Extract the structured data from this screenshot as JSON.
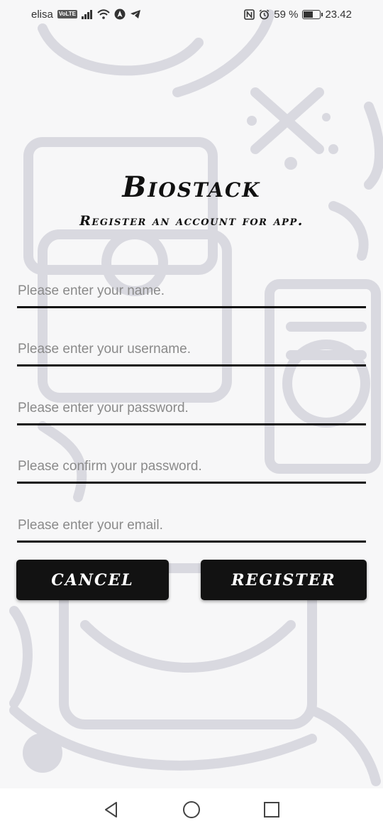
{
  "status_bar": {
    "carrier": "elisa",
    "volte_badge": "VoLTE",
    "battery_text": "59 %",
    "battery_level": 0.59,
    "time": "23.42",
    "icons": [
      "signal-icon",
      "wifi-icon",
      "navigation-icon",
      "telegram-icon",
      "nfc-icon",
      "alarm-icon",
      "battery-icon"
    ]
  },
  "header": {
    "title": "Biostack",
    "subtitle": "Register an account for app."
  },
  "form": {
    "name_placeholder": "Please enter your name.",
    "username_placeholder": "Please enter your username.",
    "password_placeholder": "Please enter your password.",
    "confirm_password_placeholder": "Please confirm your password.",
    "email_placeholder": "Please enter your email."
  },
  "actions": {
    "cancel_label": "Cancel",
    "register_label": "Register"
  },
  "nav_bar": {
    "icons": [
      "back-icon",
      "home-icon",
      "recents-icon"
    ]
  },
  "colors": {
    "background": "#f7f7f8",
    "doodle": "#d9d9e0",
    "button": "#121212",
    "button_text": "#ffffff",
    "underline": "#111111"
  }
}
